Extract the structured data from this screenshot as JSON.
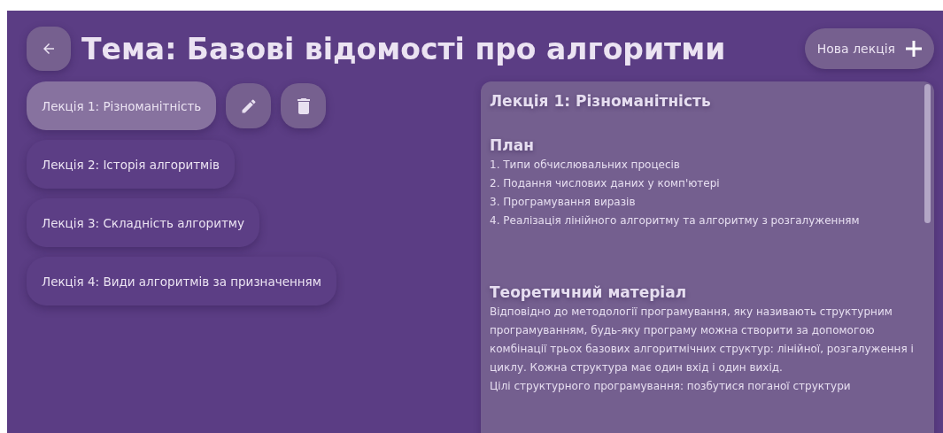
{
  "header": {
    "title": "Тема: Базові відомості про алгоритми",
    "new_button": "Нова лекція"
  },
  "lectures": [
    {
      "title": "Лекція 1: Різноманітність",
      "selected": true
    },
    {
      "title": "Лекція 2: Історія алгоритмів",
      "selected": false
    },
    {
      "title": "Лекція 3: Складність алгоритму",
      "selected": false
    },
    {
      "title": "Лекція 4: Види алгоритмів за призначенням",
      "selected": false
    }
  ],
  "content": {
    "title": "Лекція 1: Різноманітність",
    "sections": [
      {
        "kind": "list",
        "heading": "План",
        "items": [
          "1. Типи обчислювальних процесів",
          "2. Подання числових даних у комп'ютері",
          "3. Програмування виразів",
          "4. Реалізація лінійного алгоритму та алгоритму з розгалуженням"
        ]
      },
      {
        "kind": "text",
        "heading": "Теоретичний матеріал",
        "paragraphs": [
          "Відповідно до методології програмування, яку називають структурним програмуванням, будь-яку програму можна створити за допомогою комбінації трьох базових алгоритмічних структур: лінійної, розгалуження і циклу. Кожна структура має один вхід і один вихід.",
          "Цілі структурного програмування: позбутися поганої структури"
        ]
      }
    ]
  }
}
